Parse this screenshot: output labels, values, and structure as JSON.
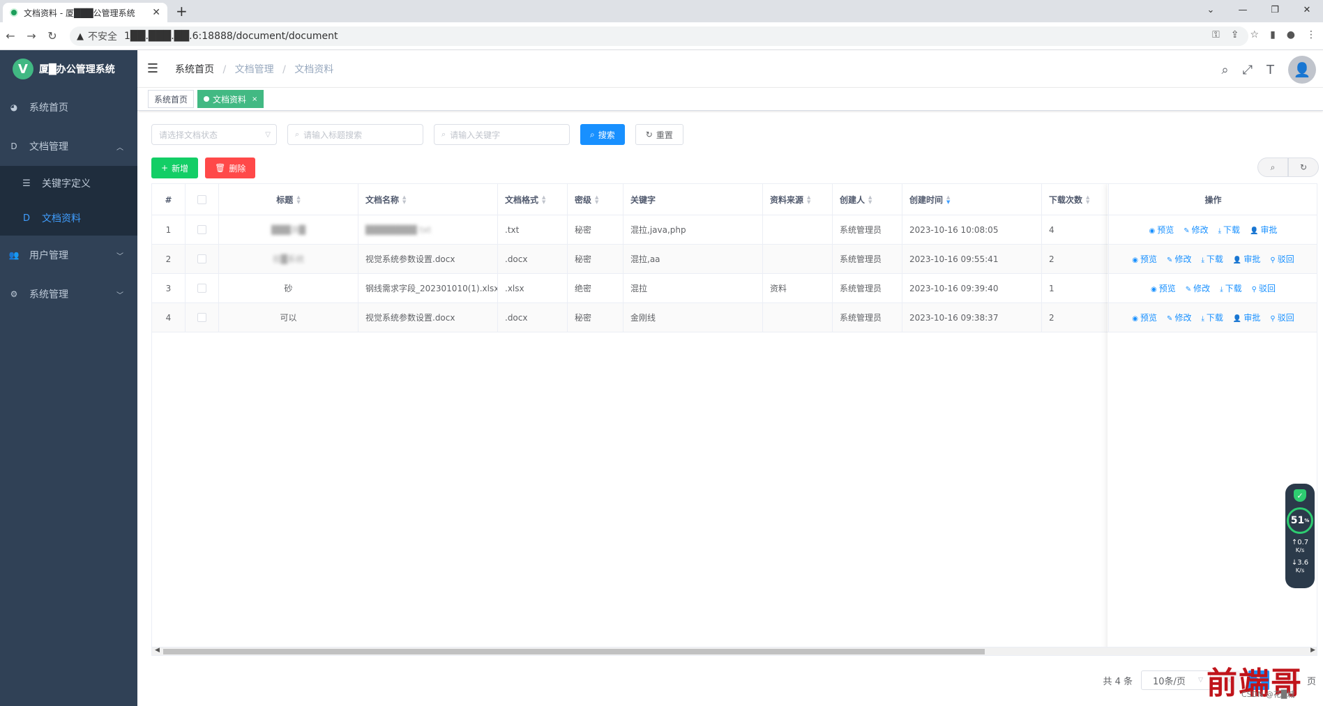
{
  "browser": {
    "tab_title": "文档资料 - 厦███公管理系统",
    "tab_close": "✕",
    "new_tab": "+",
    "insecure_label": "不安全",
    "url": "1██.███.██.6:18888/document/document"
  },
  "sidebar": {
    "logo_letter": "V",
    "logo_title": "厦█办公管理系统",
    "items": [
      {
        "label": "系统首页",
        "icon": "dashboard-icon",
        "glyph": "◕"
      },
      {
        "label": "文档管理",
        "icon": "document-icon",
        "glyph": "D",
        "expanded": true,
        "children": [
          {
            "label": "关键字定义",
            "icon": "list-icon",
            "glyph": "☰"
          },
          {
            "label": "文档资料",
            "icon": "document-icon",
            "glyph": "D",
            "active": true
          }
        ]
      },
      {
        "label": "用户管理",
        "icon": "user-group-icon",
        "glyph": "👥"
      },
      {
        "label": "系统管理",
        "icon": "gear-icon",
        "glyph": "⚙"
      }
    ]
  },
  "navbar": {
    "breadcrumb": [
      "系统首页",
      "文档管理",
      "文档资料"
    ],
    "separator": "/"
  },
  "tags": [
    {
      "label": "系统首页",
      "active": false
    },
    {
      "label": "文档资料",
      "active": true,
      "close": "×"
    }
  ],
  "filters": {
    "status_placeholder": "请选择文档状态",
    "title_placeholder": "请输入标题搜索",
    "keyword_placeholder": "请输入关键字",
    "search_label": "搜索",
    "reset_label": "重置"
  },
  "toolbar": {
    "add_label": "新增",
    "delete_label": "删除"
  },
  "table": {
    "columns": [
      "#",
      "",
      "标题",
      "文档名称",
      "文档格式",
      "密级",
      "关键字",
      "资料来源",
      "创建人",
      "创建时间",
      "下载次数",
      "操作"
    ],
    "rows": [
      {
        "idx": "1",
        "title": "███测█",
        "name": "████████ txt",
        "format": ".txt",
        "level": "秘密",
        "keywords": "混拉,java,php",
        "source": "",
        "creator": "系统管理员",
        "time": "2023-10-16 10:08:05",
        "downloads": "4",
        "ops": [
          "预览",
          "修改",
          "下载",
          "审批"
        ]
      },
      {
        "idx": "2",
        "title": "视█系统",
        "name": "视觉系统参数设置.docx",
        "format": ".docx",
        "level": "秘密",
        "keywords": "混拉,aa",
        "source": "",
        "creator": "系统管理员",
        "time": "2023-10-16 09:55:41",
        "downloads": "2",
        "ops": [
          "预览",
          "修改",
          "下载",
          "审批",
          "驳回"
        ]
      },
      {
        "idx": "3",
        "title": "砂",
        "name": "钢线需求字段_202301010(1).xlsx",
        "format": ".xlsx",
        "level": "绝密",
        "keywords": "混拉",
        "source": "资料",
        "creator": "系统管理员",
        "time": "2023-10-16 09:39:40",
        "downloads": "1",
        "ops": [
          "预览",
          "修改",
          "下载",
          "驳回"
        ]
      },
      {
        "idx": "4",
        "title": "可以",
        "name": "视觉系统参数设置.docx",
        "format": ".docx",
        "level": "秘密",
        "keywords": "金刚线",
        "source": "",
        "creator": "系统管理员",
        "time": "2023-10-16 09:38:37",
        "downloads": "2",
        "ops": [
          "预览",
          "修改",
          "下载",
          "审批",
          "驳回"
        ]
      }
    ]
  },
  "pagination": {
    "total": "共 4 条",
    "page_size": "10条/页",
    "current": "1",
    "goto_tail": "页"
  },
  "widget": {
    "percent": "51",
    "percent_unit": "%",
    "up": "0.7",
    "down": "3.6",
    "unit": "K/s"
  },
  "watermark": {
    "text": "前端哥",
    "sub": "CSDN @花█城"
  },
  "colors": {
    "sidebar_bg": "#304156",
    "primary": "#1890ff",
    "success": "#13ce66",
    "danger": "#ff4949",
    "tag_active": "#42b983"
  }
}
